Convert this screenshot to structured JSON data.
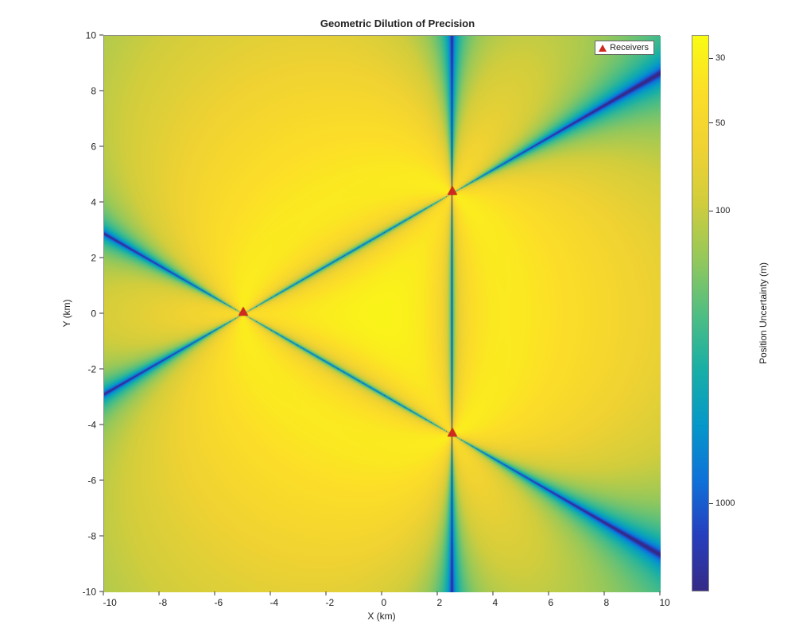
{
  "title": "Geometric Dilution of Precision",
  "xlabel": "X (km)",
  "ylabel": "Y (km)",
  "cbarlabel": "Position Uncertainty (m)",
  "legend": {
    "label": "Receivers"
  },
  "xticks": [
    "-10",
    "-8",
    "-6",
    "-4",
    "-2",
    "0",
    "2",
    "4",
    "6",
    "8",
    "10"
  ],
  "yticks": [
    "-10",
    "-8",
    "-6",
    "-4",
    "-2",
    "0",
    "2",
    "4",
    "6",
    "8",
    "10"
  ],
  "cbarticks": [
    {
      "label": "30",
      "value": 30
    },
    {
      "label": "50",
      "value": 50
    },
    {
      "label": "100",
      "value": 100
    },
    {
      "label": "1000",
      "value": 1000
    }
  ],
  "chart_data": {
    "type": "heatmap",
    "title": "Geometric Dilution of Precision",
    "xlabel": "X (km)",
    "ylabel": "Y (km)",
    "xlim": [
      -10,
      10
    ],
    "ylim": [
      -10,
      10
    ],
    "colormap": "parula",
    "color_scale": "log",
    "color_value": "Position Uncertainty (m)",
    "color_range_approx_m": [
      25,
      2000
    ],
    "receivers_km": [
      {
        "x": -5.0,
        "y": 0.0
      },
      {
        "x": 2.5,
        "y": 4.33
      },
      {
        "x": 2.5,
        "y": -4.33
      }
    ],
    "notes": "Heatmap shows GDOP-derived position uncertainty over a 20x20 km area for a 3-receiver TDOA layout at the triangle vertices. Lowest uncertainty (~25 m, yellow) near centroid; increasing outward; dark radial lobes along baselines where geometry degenerates."
  }
}
